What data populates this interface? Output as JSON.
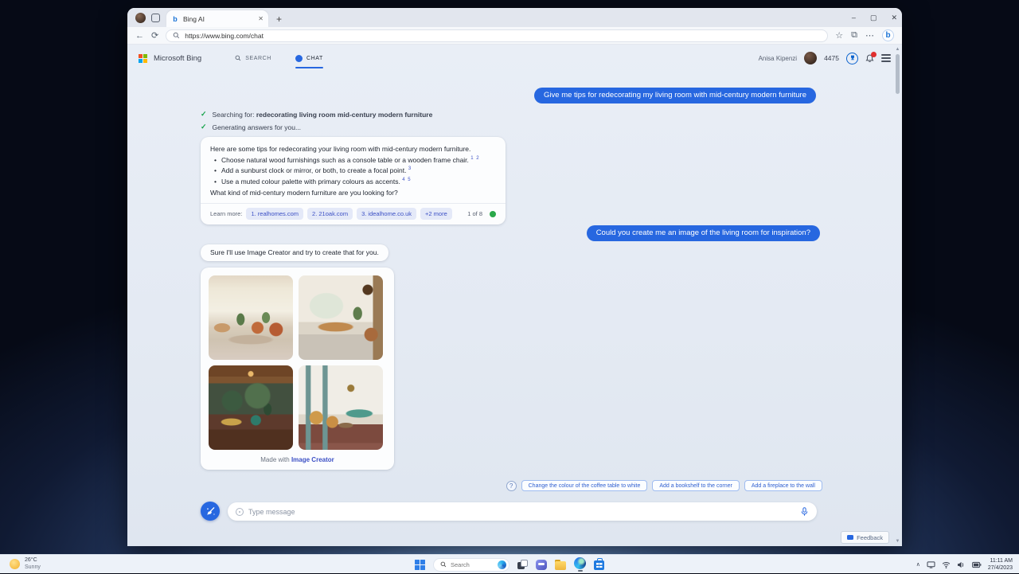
{
  "glyphs": {
    "back": "←",
    "refresh": "⟳",
    "more": "⋯",
    "win_min": "–",
    "win_max": "▢",
    "win_close": "✕",
    "tab_close": "✕",
    "new_tab": "+",
    "fav_add": "☆",
    "collections": "⧉",
    "check": "✓",
    "question": "?",
    "chevron_up": "∧",
    "scroll_up": "▲",
    "scroll_down": "▼",
    "bing_b": "b"
  },
  "browser": {
    "tab_title": "Bing AI",
    "url": "https://www.bing.com/chat"
  },
  "bing": {
    "brand": "Microsoft Bing",
    "nav_search": "SEARCH",
    "nav_chat": "CHAT",
    "user_name": "Anisa Kipenzi",
    "rewards_points": "4475"
  },
  "chat": {
    "user_message_1": "Give me tips for redecorating my living room with mid-century modern furniture",
    "searching_label": "Searching for:",
    "searching_query": "redecorating living room mid-century modern furniture",
    "generating_label": "Generating answers for you...",
    "answer_intro": "Here are some tips for redecorating your living room with mid-century modern furniture.",
    "bullets": [
      {
        "text": "Choose natural wood furnishings such as a console table or a wooden frame chair.",
        "cites": "1 2"
      },
      {
        "text": "Add a sunburst clock or mirror, or both, to create a focal point.",
        "cites": "3"
      },
      {
        "text": "Use a muted colour palette with primary colours as accents.",
        "cites": "4 5"
      }
    ],
    "answer_question": "What kind of mid-century modern furniture are you looking for?",
    "learn_more_label": "Learn more:",
    "citations": [
      "1. realhomes.com",
      "2. 21oak.com",
      "3. idealhome.co.uk",
      "+2 more"
    ],
    "pager": "1 of 8",
    "user_message_2": "Could you create me an image of the living room for inspiration?",
    "bot_message_2": "Sure I'll use Image Creator and try to create that for you.",
    "made_with_label": "Made with",
    "image_creator_link": "Image Creator",
    "suggestions": [
      "Change the colour of the coffee table to white",
      "Add a bookshelf to the corner",
      "Add a fireplace to the wall"
    ],
    "input_placeholder": "Type message",
    "feedback_label": "Feedback"
  },
  "taskbar": {
    "weather_temp": "26°C",
    "weather_condition": "Sunny",
    "search_placeholder": "Search",
    "time": "11:11 AM",
    "date": "27/4/2023"
  },
  "colors": {
    "accent_blue": "#2767e0",
    "citation_text": "#3c50c5",
    "check_green": "#16a34a",
    "pager_dot_green": "#2aa84a"
  }
}
